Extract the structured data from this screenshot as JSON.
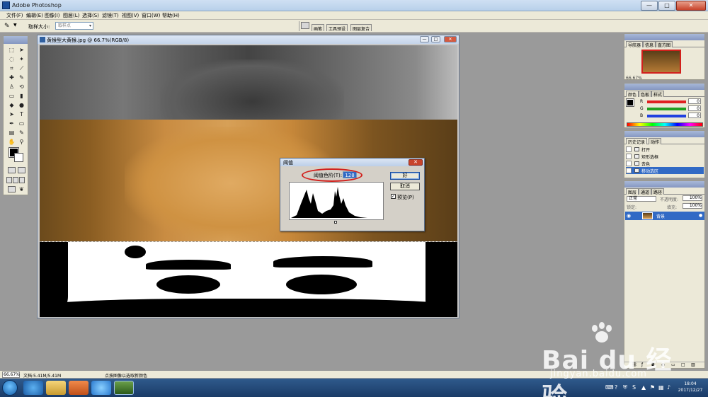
{
  "window": {
    "title": "Adobe Photoshop",
    "min": "—",
    "max": "□",
    "close": "✕"
  },
  "menu": [
    "文件(F)",
    "编辑(E)",
    "图像(I)",
    "图层(L)",
    "选择(S)",
    "滤镜(T)",
    "视图(V)",
    "窗口(W)",
    "帮助(H)"
  ],
  "options": {
    "sample_label": "取样大小:",
    "sample_value": "取样点",
    "well_tabs": [
      "画笔",
      "工具预设",
      "图层复合"
    ]
  },
  "document": {
    "title": "黄猴型大黄猴.jpg @ 66.7%(RGB/8)"
  },
  "dialog": {
    "title": "阈值",
    "level_label": "阈值色阶(T):",
    "level_value": "128",
    "ok": "好",
    "cancel": "取消",
    "preview_label": "预览(P)",
    "preview_checked": "✓",
    "close": "✕"
  },
  "navigator": {
    "tabs": [
      "导航器",
      "信息",
      "直方图"
    ],
    "zoom": "66.67%"
  },
  "color_panel": {
    "tabs": [
      "颜色",
      "色板",
      "样式"
    ],
    "channels": [
      {
        "label": "R",
        "value": "0",
        "color": "#e02020"
      },
      {
        "label": "G",
        "value": "0",
        "color": "#20a020"
      },
      {
        "label": "B",
        "value": "0",
        "color": "#2040e0"
      }
    ]
  },
  "history": {
    "tabs": [
      "历史记录",
      "动作"
    ],
    "items": [
      "打开",
      "矩形选框",
      "去色",
      "移动选区"
    ]
  },
  "layers": {
    "tabs": [
      "图层",
      "通道",
      "路径"
    ],
    "blend_mode": "正常",
    "opacity_label": "不透明度:",
    "opacity": "100%",
    "lock_label": "锁定:",
    "fill_label": "填充:",
    "fill": "100%",
    "layer_name": "背景"
  },
  "status": {
    "zoom": "66.67%",
    "doc": "文档:5.41M/5.41M",
    "tip": "点按图像以选取新颜色"
  },
  "taskbar": {
    "time": "18:04",
    "date": "2017/12/27"
  },
  "watermark": {
    "brand": "Bai du 经验",
    "domain": "jingyan.baidu.com"
  },
  "colors": {
    "accent": "#316ac5",
    "annotation": "#d2201c"
  }
}
